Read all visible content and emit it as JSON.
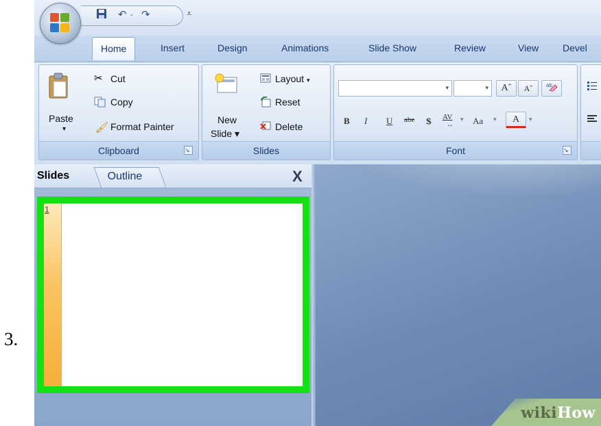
{
  "step_number": "3.",
  "quick_access": {
    "save_icon": "save-icon",
    "undo_icon": "undo-icon",
    "redo_icon": "redo-icon",
    "customize_icon": "customize-arrow-icon"
  },
  "tabs": [
    {
      "label": "Home",
      "active": true
    },
    {
      "label": "Insert"
    },
    {
      "label": "Design"
    },
    {
      "label": "Animations"
    },
    {
      "label": "Slide Show"
    },
    {
      "label": "Review"
    },
    {
      "label": "View"
    },
    {
      "label": "Devel"
    }
  ],
  "ribbon": {
    "clipboard": {
      "label": "Clipboard",
      "paste": "Paste",
      "cut": "Cut",
      "copy": "Copy",
      "format_painter": "Format Painter"
    },
    "slides": {
      "label": "Slides",
      "new_slide_line1": "New",
      "new_slide_line2": "Slide",
      "layout": "Layout",
      "reset": "Reset",
      "delete": "Delete"
    },
    "font": {
      "label": "Font",
      "bold": "B",
      "italic": "I",
      "underline": "U",
      "strike": "abe",
      "shadow": "S",
      "spacing": "AV",
      "change_case": "Aa",
      "color": "A",
      "grow": "Aˆ",
      "shrink": "Aˇ"
    }
  },
  "pane": {
    "tab_slides": "Slides",
    "tab_outline": "Outline",
    "close": "X",
    "slide_number": "1"
  },
  "watermark": {
    "wiki": "wiki",
    "how": "How"
  },
  "colors": {
    "highlight": "#14e014",
    "slide_strip": "#f7ae3a"
  }
}
